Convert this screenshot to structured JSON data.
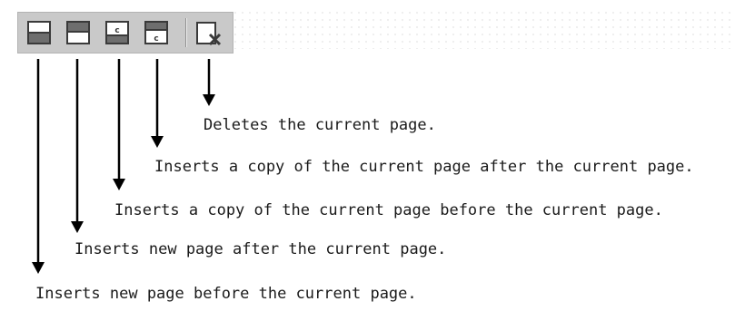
{
  "toolbar": {
    "buttons": [
      {
        "name": "insert-page-before-icon"
      },
      {
        "name": "insert-page-after-icon"
      },
      {
        "name": "insert-copy-before-icon"
      },
      {
        "name": "insert-copy-after-icon"
      },
      {
        "name": "delete-page-icon"
      }
    ]
  },
  "callouts": {
    "delete_page": "Deletes the current page.",
    "insert_copy_after": "Inserts a copy of the current page after the current page.",
    "insert_copy_before": "Inserts a copy of the current page before the current page.",
    "insert_page_after": "Inserts new page after the current page.",
    "insert_page_before": "Inserts new page before the current page."
  },
  "colors": {
    "toolbar_bg": "#c9c9c9",
    "icon_stroke": "#3a3a3a",
    "arrow": "#000000",
    "text": "#1a1a1a"
  }
}
